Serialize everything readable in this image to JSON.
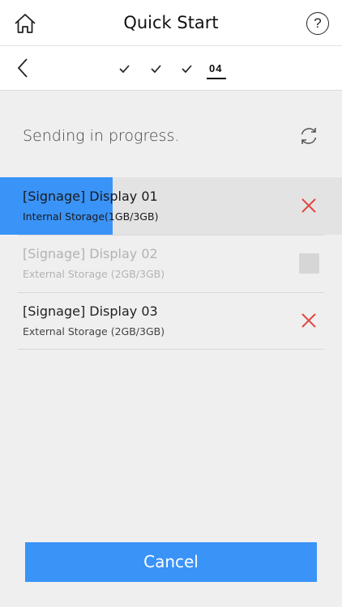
{
  "header": {
    "title": "Quick Start",
    "help_label": "?",
    "home_icon": "home-icon",
    "help_icon": "help-icon"
  },
  "stepper": {
    "back_icon": "chevron-left-icon",
    "completed_steps": 3,
    "current_step_label": "04"
  },
  "status": {
    "text": "Sending in progress.",
    "refresh_icon": "refresh-icon"
  },
  "devices": [
    {
      "name": "[Signage] Display 01",
      "storage": "Internal Storage(1GB/3GB)",
      "state": "sending",
      "progress": 0.33,
      "action_icon": "close-icon"
    },
    {
      "name": "[Signage] Display 02",
      "storage": "External Storage (2GB/3GB)",
      "state": "disabled",
      "action_icon": "checkbox-icon"
    },
    {
      "name": "[Signage] Display 03",
      "storage": "External Storage (2GB/3GB)",
      "state": "queued",
      "action_icon": "close-icon"
    }
  ],
  "footer": {
    "cancel_label": "Cancel"
  },
  "colors": {
    "accent": "#3a93f7",
    "danger": "#e0453f",
    "background": "#efefef"
  }
}
